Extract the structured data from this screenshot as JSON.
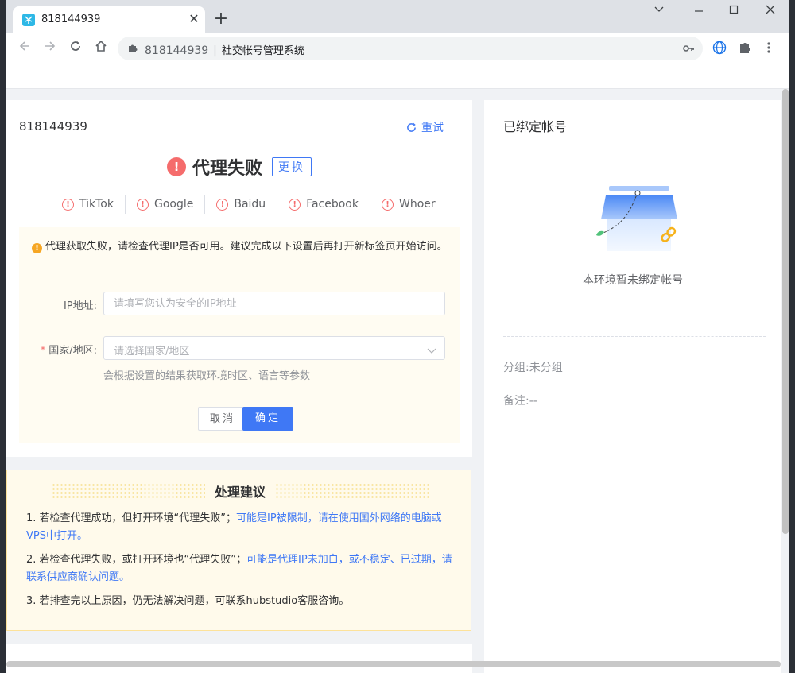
{
  "browser": {
    "tab_title": "818144939",
    "address_host": "818144939",
    "address_title": "社交帐号管理系统"
  },
  "left": {
    "env_id": "818144939",
    "retry_label": "重试",
    "status_text": "代理失败",
    "change_label": "更换",
    "sites": [
      "TikTok",
      "Google",
      "Baidu",
      "Facebook",
      "Whoer"
    ],
    "warning": "代理获取失败，请检查代理IP是否可用。建议完成以下设置后再打开新标签页开始访问。",
    "ip_label": "IP地址:",
    "ip_placeholder": "请填写您认为安全的IP地址",
    "country_label": "国家/地区:",
    "country_placeholder": "请选择国家/地区",
    "hint": "会根据设置的结果获取环境时区、语言等参数",
    "cancel_label": "取消",
    "ok_label": "确定"
  },
  "advice": {
    "title": "处理建议",
    "items": [
      {
        "prefix": "1. 若检查代理成功，但打开环境“代理失败”；",
        "highlight": "可能是IP被限制，请在使用国外网络的电脑或VPS中打开。"
      },
      {
        "prefix": "2. 若检查代理失败，或打开环境也“代理失败”；",
        "highlight": "可能是代理IP未加白，或不稳定、已过期，请联系供应商确认问题。"
      },
      {
        "prefix": "3. 若排查完以上原因，仍无法解决问题，可联系hubstudio客服咨询。",
        "highlight": ""
      }
    ]
  },
  "right": {
    "title": "已绑定帐号",
    "empty_text": "本环境暂未绑定帐号",
    "group_label": "分组:",
    "group_value": "未分组",
    "note_label": "备注:",
    "note_value": "--"
  },
  "colors": {
    "accent": "#3f78f5",
    "error": "#f56c6c",
    "warning": "#f6a623"
  }
}
